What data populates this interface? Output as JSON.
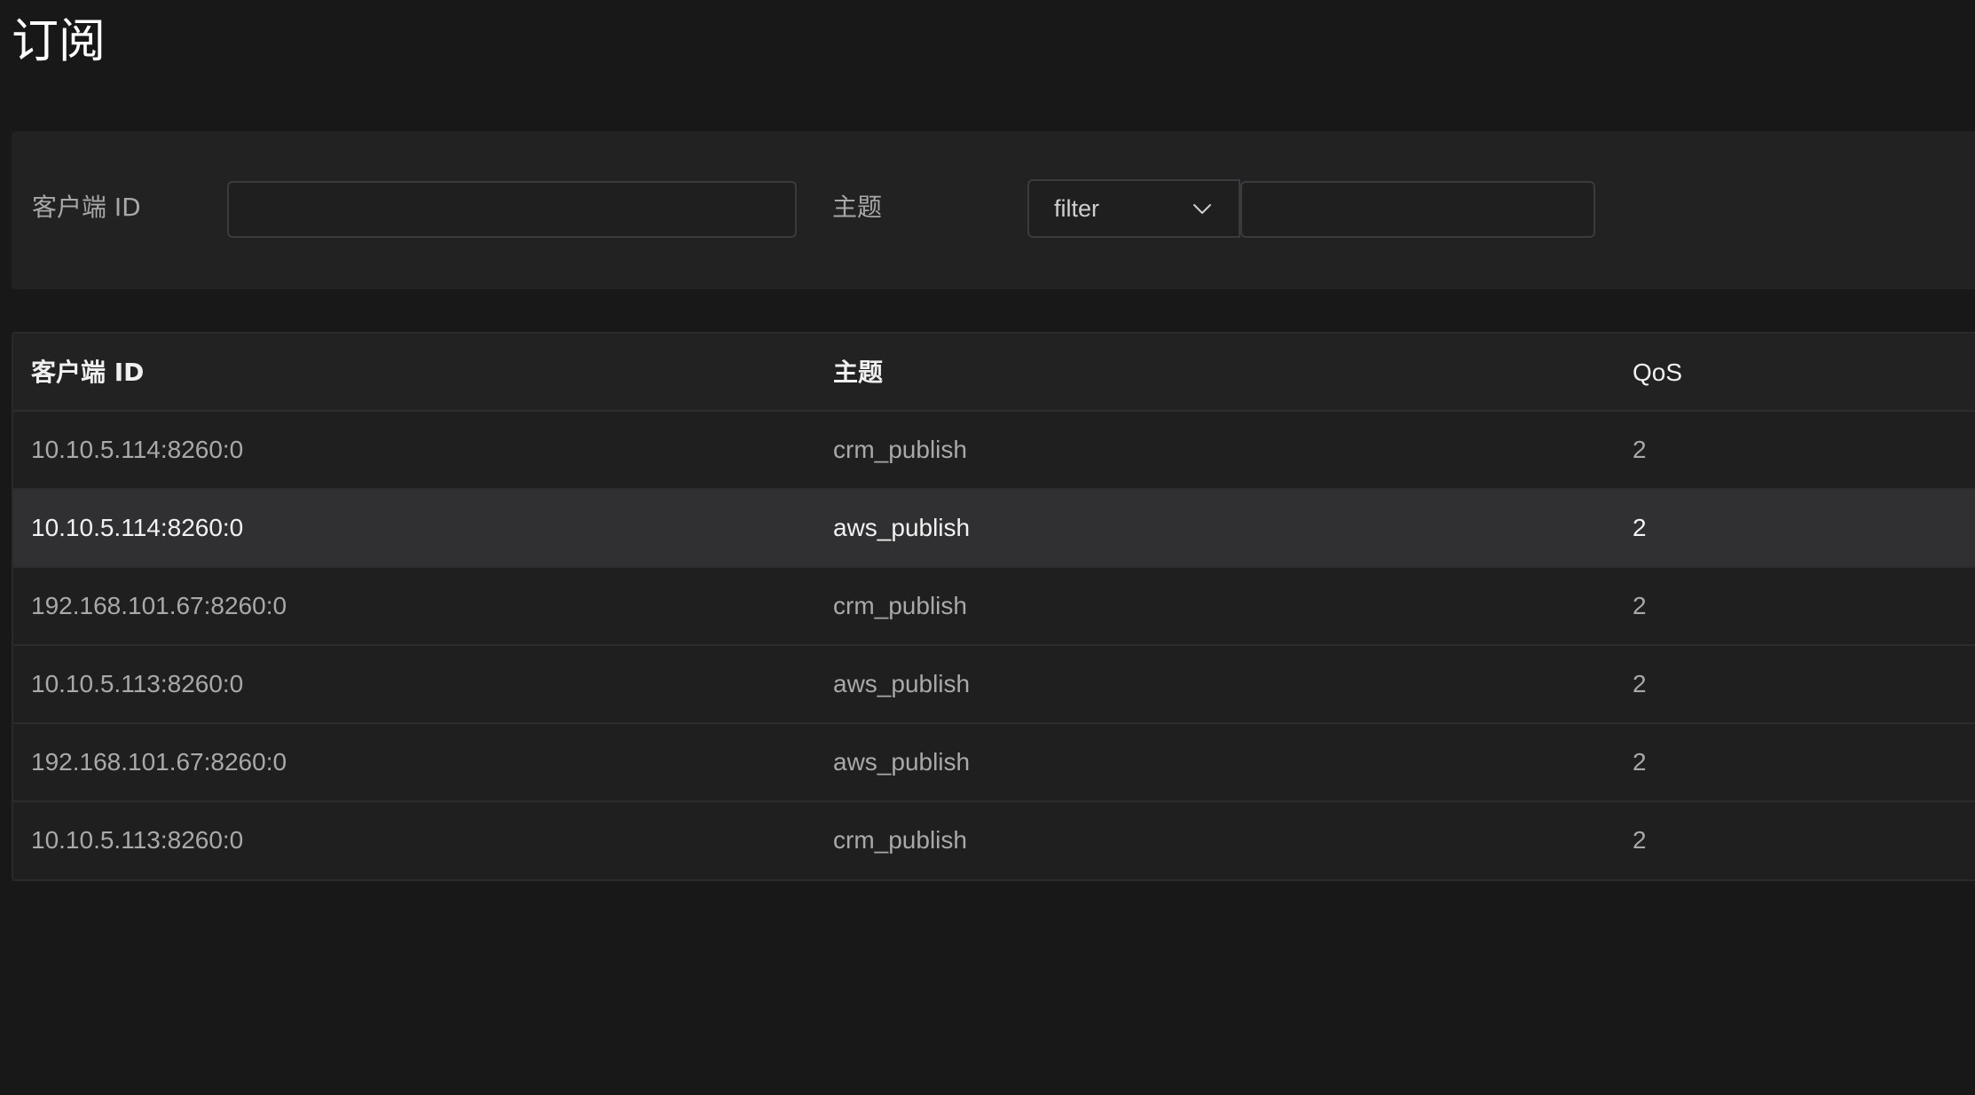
{
  "page": {
    "title": "订阅"
  },
  "filters": {
    "client_id_label": "客户端 ID",
    "client_id_value": "",
    "topic_label": "主题",
    "topic_match_type": "filter",
    "topic_value": ""
  },
  "table": {
    "columns": [
      "客户端 ID",
      "主题",
      "QoS"
    ],
    "rows": [
      {
        "client_id": "10.10.5.114:8260:0",
        "topic": "crm_publish",
        "qos": "2"
      },
      {
        "client_id": "10.10.5.114:8260:0",
        "topic": "aws_publish",
        "qos": "2"
      },
      {
        "client_id": "192.168.101.67:8260:0",
        "topic": "crm_publish",
        "qos": "2"
      },
      {
        "client_id": "10.10.5.113:8260:0",
        "topic": "aws_publish",
        "qos": "2"
      },
      {
        "client_id": "192.168.101.67:8260:0",
        "topic": "aws_publish",
        "qos": "2"
      },
      {
        "client_id": "10.10.5.113:8260:0",
        "topic": "crm_publish",
        "qos": "2"
      }
    ]
  },
  "icons": {
    "select_arrow": "chevron-down-icon"
  },
  "colors": {
    "background": "#181818",
    "panel": "#222223",
    "row_hover": "#303032",
    "border": "#3b3b3d"
  }
}
